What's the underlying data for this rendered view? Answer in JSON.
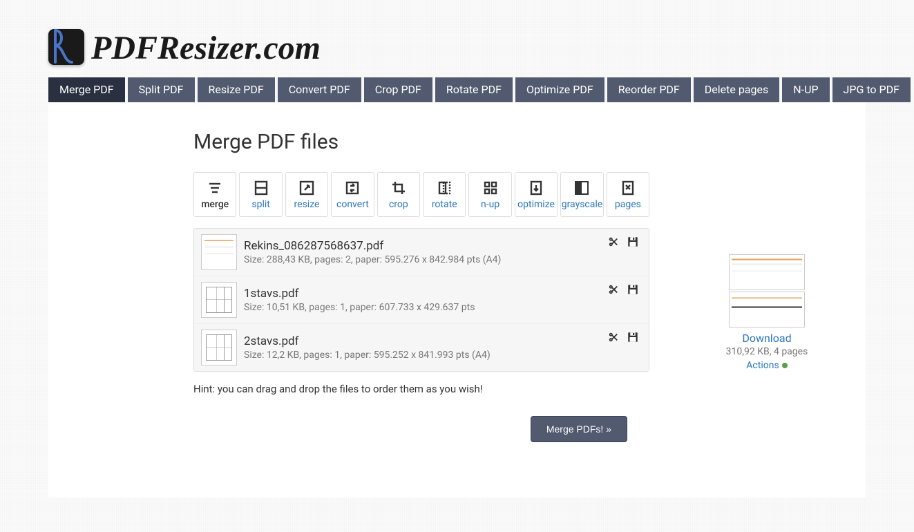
{
  "brand": "PDFResizer.com",
  "nav": {
    "items": [
      {
        "label": "Merge PDF",
        "active": true
      },
      {
        "label": "Split PDF"
      },
      {
        "label": "Resize PDF"
      },
      {
        "label": "Convert PDF"
      },
      {
        "label": "Crop PDF"
      },
      {
        "label": "Rotate PDF"
      },
      {
        "label": "Optimize PDF"
      },
      {
        "label": "Reorder PDF"
      },
      {
        "label": "Delete pages"
      },
      {
        "label": "N-UP"
      },
      {
        "label": "JPG to PDF"
      }
    ]
  },
  "page_title": "Merge PDF files",
  "toolbar": {
    "items": [
      {
        "label": "merge",
        "active": true,
        "icon": "merge"
      },
      {
        "label": "split",
        "icon": "split"
      },
      {
        "label": "resize",
        "icon": "resize"
      },
      {
        "label": "convert",
        "icon": "convert"
      },
      {
        "label": "crop",
        "icon": "crop"
      },
      {
        "label": "rotate",
        "icon": "rotate"
      },
      {
        "label": "n-up",
        "icon": "nup"
      },
      {
        "label": "optimize",
        "icon": "optimize"
      },
      {
        "label": "grayscale",
        "icon": "grayscale"
      },
      {
        "label": "pages",
        "icon": "pages"
      }
    ]
  },
  "files": [
    {
      "name": "Rekins_086287568637.pdf",
      "meta": "Size: 288,43 KB, pages: 2, paper: 595.276 x 842.984 pts (A4)",
      "thumb": "invoice"
    },
    {
      "name": "1stavs.pdf",
      "meta": "Size: 10,51 KB, pages: 1, paper: 607.733 x 429.637 pts",
      "thumb": "plan"
    },
    {
      "name": "2stavs.pdf",
      "meta": "Size: 12,2 KB, pages: 1, paper: 595.252 x 841.993 pts (A4)",
      "thumb": "plan"
    }
  ],
  "hint": "Hint: you can drag and drop the files to order them as you wish!",
  "merge_button": "Merge PDFs! »",
  "result": {
    "download_label": "Download",
    "meta": "310,92 KB, 4 pages",
    "actions_label": "Actions"
  }
}
